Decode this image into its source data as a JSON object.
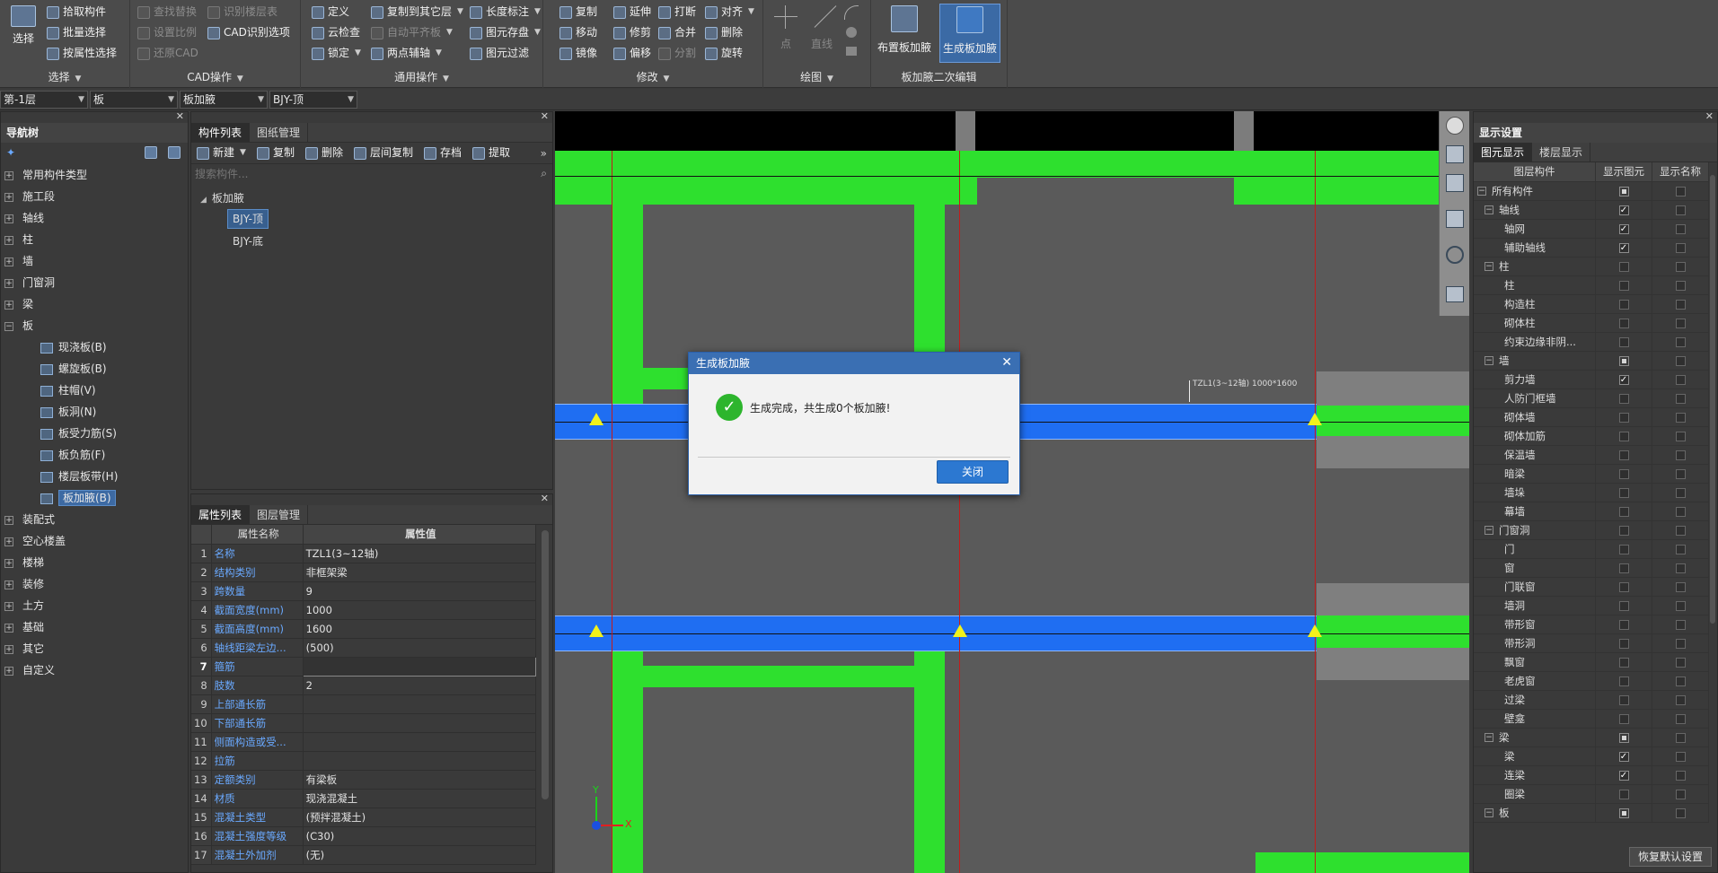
{
  "ribbon": {
    "select": {
      "big_label": "选择",
      "items": [
        "拾取构件",
        "批量选择",
        "按属性选择"
      ],
      "group": "选择"
    },
    "cad": {
      "items": [
        "查找替换",
        "识别楼层表",
        "设置比例",
        "CAD识别选项",
        "还原CAD"
      ],
      "group": "CAD操作"
    },
    "common": {
      "items": [
        "定义",
        "复制到其它层",
        "长度标注",
        "云检查",
        "自动平齐板",
        "图元存盘",
        "锁定",
        "两点辅轴",
        "图元过滤"
      ],
      "group": "通用操作"
    },
    "modify": {
      "items": [
        "复制",
        "延伸",
        "打断",
        "对齐",
        "移动",
        "修剪",
        "合并",
        "删除",
        "镜像",
        "偏移",
        "分割",
        "旋转"
      ],
      "group": "修改"
    },
    "draw": {
      "items": [
        "点",
        "直线"
      ],
      "group": "绘图"
    },
    "haunch": {
      "items": [
        "布置板加腋",
        "生成板加腋"
      ],
      "group": "板加腋二次编辑"
    }
  },
  "selectors": {
    "floor": "第-1层",
    "category": "板",
    "type": "板加腋",
    "member": "BJY-顶"
  },
  "nav": {
    "title": "导航树",
    "items": [
      "常用构件类型",
      "施工段",
      "轴线",
      "柱",
      "墙",
      "门窗洞",
      "梁",
      "板"
    ],
    "board_children": [
      "现浇板(B)",
      "螺旋板(B)",
      "柱帽(V)",
      "板洞(N)",
      "板受力筋(S)",
      "板负筋(F)",
      "楼层板带(H)",
      "板加腋(B)"
    ],
    "items_after": [
      "装配式",
      "空心楼盖",
      "楼梯",
      "装修",
      "土方",
      "基础",
      "其它",
      "自定义"
    ]
  },
  "comp_list": {
    "tabs": [
      "构件列表",
      "图纸管理"
    ],
    "toolbar": [
      "新建",
      "复制",
      "删除",
      "层间复制",
      "存档",
      "提取"
    ],
    "search_placeholder": "搜索构件...",
    "root": "板加腋",
    "children": [
      "BJY-顶",
      "BJY-底"
    ]
  },
  "props": {
    "tabs": [
      "属性列表",
      "图层管理"
    ],
    "header": [
      "属性名称",
      "属性值"
    ],
    "rows": [
      [
        "1",
        "名称",
        "TZL1(3~12轴)"
      ],
      [
        "2",
        "结构类别",
        "非框架梁"
      ],
      [
        "3",
        "跨数量",
        "9"
      ],
      [
        "4",
        "截面宽度(mm)",
        "1000"
      ],
      [
        "5",
        "截面高度(mm)",
        "1600"
      ],
      [
        "6",
        "轴线距梁左边...",
        "(500)"
      ],
      [
        "7",
        "箍筋",
        ""
      ],
      [
        "8",
        "肢数",
        "2"
      ],
      [
        "9",
        "上部通长筋",
        ""
      ],
      [
        "10",
        "下部通长筋",
        ""
      ],
      [
        "11",
        "侧面构造或受...",
        ""
      ],
      [
        "12",
        "拉筋",
        ""
      ],
      [
        "13",
        "定额类别",
        "有梁板"
      ],
      [
        "14",
        "材质",
        "现浇混凝土"
      ],
      [
        "15",
        "混凝土类型",
        "(预拌混凝土)"
      ],
      [
        "16",
        "混凝土强度等级",
        "(C30)"
      ],
      [
        "17",
        "混凝土外加剂",
        "(无)"
      ]
    ]
  },
  "display": {
    "title": "显示设置",
    "tabs": [
      "图元显示",
      "楼层显示"
    ],
    "header": [
      "图层构件",
      "显示图元",
      "显示名称"
    ],
    "rows": [
      {
        "name": "所有构件",
        "level": 0,
        "show": "part",
        "label": "off"
      },
      {
        "name": "轴线",
        "level": 1,
        "show": "on",
        "label": "off"
      },
      {
        "name": "轴网",
        "level": 2,
        "show": "on",
        "label": "off"
      },
      {
        "name": "辅助轴线",
        "level": 2,
        "show": "on",
        "label": "off"
      },
      {
        "name": "柱",
        "level": 1,
        "show": "off",
        "label": "off"
      },
      {
        "name": "柱",
        "level": 2,
        "show": "off",
        "label": "off"
      },
      {
        "name": "构造柱",
        "level": 2,
        "show": "off",
        "label": "off"
      },
      {
        "name": "砌体柱",
        "level": 2,
        "show": "off",
        "label": "off"
      },
      {
        "name": "约束边缘非阴...",
        "level": 2,
        "show": "off",
        "label": "off"
      },
      {
        "name": "墙",
        "level": 1,
        "show": "part",
        "label": "off"
      },
      {
        "name": "剪力墙",
        "level": 2,
        "show": "on",
        "label": "off"
      },
      {
        "name": "人防门框墙",
        "level": 2,
        "show": "off",
        "label": "off"
      },
      {
        "name": "砌体墙",
        "level": 2,
        "show": "off",
        "label": "off"
      },
      {
        "name": "砌体加筋",
        "level": 2,
        "show": "off",
        "label": "off"
      },
      {
        "name": "保温墙",
        "level": 2,
        "show": "off",
        "label": "off"
      },
      {
        "name": "暗梁",
        "level": 2,
        "show": "off",
        "label": "off"
      },
      {
        "name": "墙垛",
        "level": 2,
        "show": "off",
        "label": "off"
      },
      {
        "name": "幕墙",
        "level": 2,
        "show": "off",
        "label": "off"
      },
      {
        "name": "门窗洞",
        "level": 1,
        "show": "off",
        "label": "off"
      },
      {
        "name": "门",
        "level": 2,
        "show": "off",
        "label": "off"
      },
      {
        "name": "窗",
        "level": 2,
        "show": "off",
        "label": "off"
      },
      {
        "name": "门联窗",
        "level": 2,
        "show": "off",
        "label": "off"
      },
      {
        "name": "墙洞",
        "level": 2,
        "show": "off",
        "label": "off"
      },
      {
        "name": "带形窗",
        "level": 2,
        "show": "off",
        "label": "off"
      },
      {
        "name": "带形洞",
        "level": 2,
        "show": "off",
        "label": "off"
      },
      {
        "name": "飘窗",
        "level": 2,
        "show": "off",
        "label": "off"
      },
      {
        "name": "老虎窗",
        "level": 2,
        "show": "off",
        "label": "off"
      },
      {
        "name": "过梁",
        "level": 2,
        "show": "off",
        "label": "off"
      },
      {
        "name": "壁龛",
        "level": 2,
        "show": "off",
        "label": "off"
      },
      {
        "name": "梁",
        "level": 1,
        "show": "part",
        "label": "off"
      },
      {
        "name": "梁",
        "level": 2,
        "show": "on",
        "label": "off"
      },
      {
        "name": "连梁",
        "level": 2,
        "show": "on",
        "label": "off"
      },
      {
        "name": "圈梁",
        "level": 2,
        "show": "off",
        "label": "off"
      },
      {
        "name": "板",
        "level": 1,
        "show": "part",
        "label": "off"
      }
    ],
    "reset_button": "恢复默认设置"
  },
  "canvas": {
    "beam_note": "TZL1(3~12轴) 1000*1600",
    "axis_y": "Y",
    "axis_x": "X"
  },
  "dialog": {
    "title": "生成板加腋",
    "message": "生成完成，共生成0个板加腋!",
    "close_button": "关闭"
  }
}
